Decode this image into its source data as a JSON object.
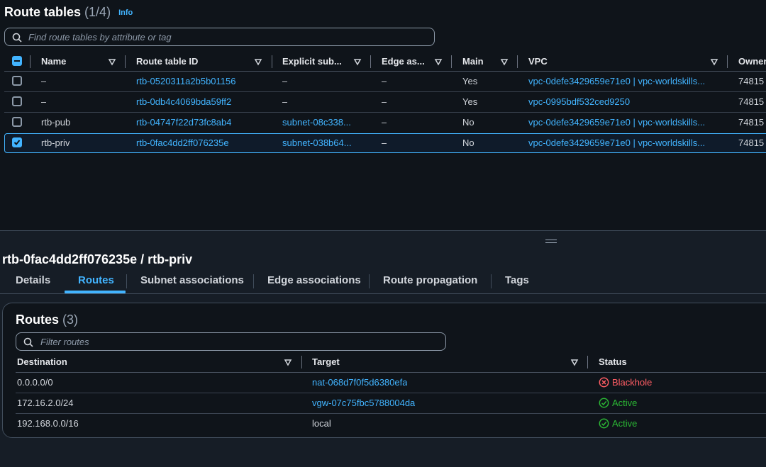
{
  "route_tables": {
    "title": "Route tables",
    "count": "(1/4)",
    "info_label": "Info",
    "search_placeholder": "Find route tables by attribute or tag",
    "columns": [
      "Name",
      "Route table ID",
      "Explicit sub...",
      "Edge as...",
      "Main",
      "VPC",
      "Owner"
    ],
    "rows": [
      {
        "name": "–",
        "id": "rtb-0520311a2b5b01156",
        "subnet": "–",
        "edge": "–",
        "main": "Yes",
        "vpc": "vpc-0defe3429659e71e0 | vpc-worldskills...",
        "owner": "74815",
        "selected": false
      },
      {
        "name": "–",
        "id": "rtb-0db4c4069bda59ff2",
        "subnet": "–",
        "edge": "–",
        "main": "Yes",
        "vpc": "vpc-0995bdf532ced9250",
        "owner": "74815",
        "selected": false
      },
      {
        "name": "rtb-pub",
        "id": "rtb-04747f22d73fc8ab4",
        "subnet": "subnet-08c338...",
        "edge": "–",
        "main": "No",
        "vpc": "vpc-0defe3429659e71e0 | vpc-worldskills...",
        "owner": "74815",
        "selected": false
      },
      {
        "name": "rtb-priv",
        "id": "rtb-0fac4dd2ff076235e",
        "subnet": "subnet-038b64...",
        "edge": "–",
        "main": "No",
        "vpc": "vpc-0defe3429659e71e0 | vpc-worldskills...",
        "owner": "74815",
        "selected": true
      }
    ]
  },
  "detail": {
    "title": "rtb-0fac4dd2ff076235e / rtb-priv",
    "tabs": [
      "Details",
      "Routes",
      "Subnet associations",
      "Edge associations",
      "Route propagation",
      "Tags"
    ],
    "active_tab": "Routes"
  },
  "routes": {
    "title": "Routes",
    "count": "(3)",
    "search_placeholder": "Filter routes",
    "columns": [
      "Destination",
      "Target",
      "Status"
    ],
    "rows": [
      {
        "destination": "0.0.0.0/0",
        "target": "nat-068d7f0f5d6380efa",
        "target_link": true,
        "status": "Blackhole"
      },
      {
        "destination": "172.16.2.0/24",
        "target": "vgw-07c75fbc5788004da",
        "target_link": true,
        "status": "Active"
      },
      {
        "destination": "192.168.0.0/16",
        "target": "local",
        "target_link": false,
        "status": "Active"
      }
    ]
  },
  "colors": {
    "link": "#42b4ff",
    "active": "#2bb534",
    "blackhole": "#ff5d64",
    "background": "#0f141a"
  }
}
